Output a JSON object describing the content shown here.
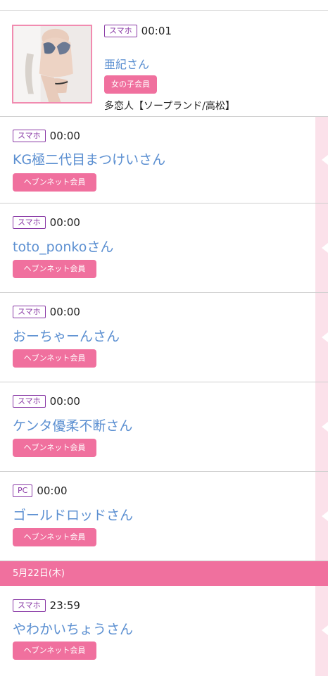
{
  "featured": {
    "device": "スマホ",
    "time": "00:01",
    "name": "亜紀さん",
    "badge": "女の子会員",
    "shop": "多恋人【ソープランド/高松】"
  },
  "entries": [
    {
      "device": "スマホ",
      "time": "00:00",
      "name": "KG極二代目まつけいさん",
      "badge": "ヘブンネット会員"
    },
    {
      "device": "スマホ",
      "time": "00:00",
      "name": "toto_ponkoさん",
      "badge": "ヘブンネット会員"
    },
    {
      "device": "スマホ",
      "time": "00:00",
      "name": "おーちゃーんさん",
      "badge": "ヘブンネット会員"
    },
    {
      "device": "スマホ",
      "time": "00:00",
      "name": "ケンタ優柔不断さん",
      "badge": "ヘブンネット会員"
    },
    {
      "device": "PC",
      "time": "00:00",
      "name": "ゴールドロッドさん",
      "badge": "ヘブンネット会員"
    }
  ],
  "date_header": "5月22日(木)",
  "after_date_entries": [
    {
      "device": "スマホ",
      "time": "23:59",
      "name": "やわかいちょうさん",
      "badge": "ヘブンネット会員"
    }
  ],
  "colors": {
    "accent_pink": "#f0709e",
    "device_purple": "#8a3aa6",
    "name_blue": "#5b8fd1",
    "strip_pink": "#fbe1ea"
  }
}
